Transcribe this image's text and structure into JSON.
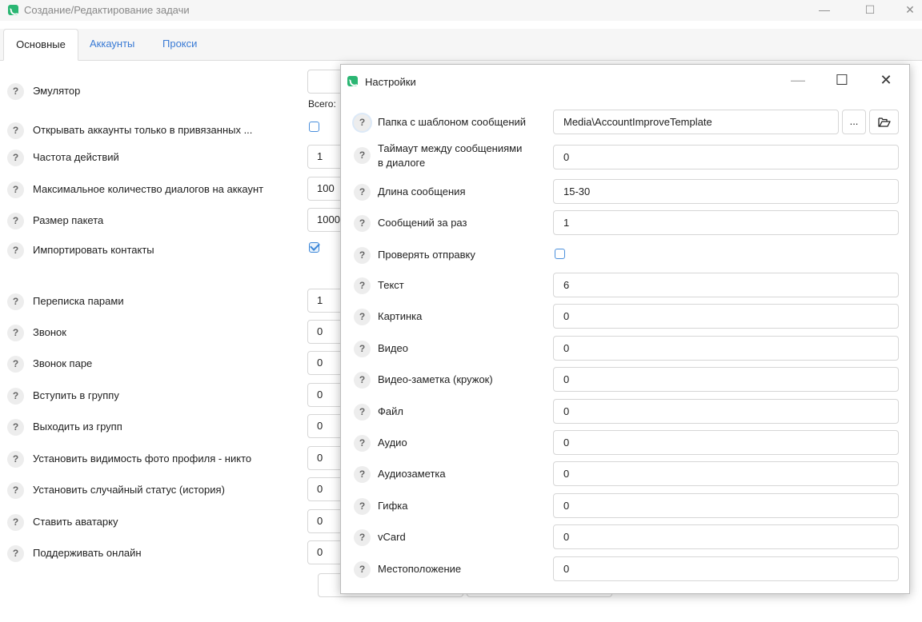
{
  "main_window": {
    "title": "Создание/Редактирование задачи",
    "controls": {
      "minimize": "—",
      "maximize": "☐",
      "close": "✕"
    },
    "tabs": [
      {
        "label": "Основные"
      },
      {
        "label": "Аккаунты"
      },
      {
        "label": "Прокси"
      }
    ],
    "total_label": "Всего:",
    "rows": [
      {
        "label": "Эмулятор",
        "value": ""
      },
      {
        "label": "Открывать аккаунты только в привязанных ...",
        "checked": false
      },
      {
        "label": "Частота действий",
        "value": "1"
      },
      {
        "label": "Максимальное количество диалогов на аккаунт",
        "value": "100"
      },
      {
        "label": "Размер пакета",
        "value": "1000"
      },
      {
        "label": "Импортировать контакты",
        "checked": true
      },
      {
        "label": "Переписка парами",
        "value": "1"
      },
      {
        "label": "Звонок",
        "value": "0"
      },
      {
        "label": "Звонок паре",
        "value": "0"
      },
      {
        "label": "Вступить в группу",
        "value": "0"
      },
      {
        "label": "Выходить из групп",
        "value": "0"
      },
      {
        "label": "Установить видимость фото профиля - никто",
        "value": "0"
      },
      {
        "label": "Установить случайный статус (история)",
        "value": "0"
      },
      {
        "label": "Ставить аватарку",
        "value": "0"
      },
      {
        "label": "Поддерживать онлайн",
        "value": "0"
      }
    ]
  },
  "settings_dialog": {
    "title": "Настройки",
    "controls": {
      "minimize": "—",
      "maximize": "☐",
      "close": "✕"
    },
    "template_folder": {
      "label": "Папка с шаблоном сообщений",
      "value": "Media\\AccountImproveTemplate",
      "browse": "...",
      "open_icon": "folder-open-icon"
    },
    "timeout": {
      "label_line1": "Таймаут между сообщениями",
      "label_line2": "в диалоге",
      "value": "0"
    },
    "message_length": {
      "label": "Длина сообщения",
      "value": "15-30"
    },
    "messages_per_time": {
      "label": "Сообщений за раз",
      "value": "1"
    },
    "check_sending": {
      "label": "Проверять отправку",
      "checked": false
    },
    "fields": [
      {
        "label": "Текст",
        "value": "6"
      },
      {
        "label": "Картинка",
        "value": "0"
      },
      {
        "label": "Видео",
        "value": "0"
      },
      {
        "label": "Видео-заметка (кружок)",
        "value": "0"
      },
      {
        "label": "Файл",
        "value": "0"
      },
      {
        "label": "Аудио",
        "value": "0"
      },
      {
        "label": "Аудиозаметка",
        "value": "0"
      },
      {
        "label": "Гифка",
        "value": "0"
      },
      {
        "label": "vCard",
        "value": "0"
      },
      {
        "label": "Местоположение",
        "value": "0"
      }
    ]
  },
  "help_glyph": "?",
  "colors": {
    "brand": "#2bb673",
    "link": "#3a7bd5",
    "checkbox": "#4a8fdc"
  }
}
